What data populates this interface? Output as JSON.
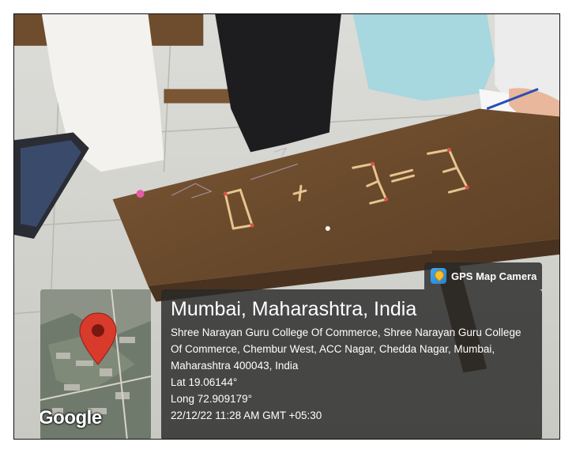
{
  "stamp": {
    "app_badge_label": "GPS Map Camera",
    "app_badge_icon": "map-pin-app-icon",
    "location_title": "Mumbai, Maharashtra, India",
    "address": "Shree Narayan Guru College Of Commerce, Shree Narayan Guru College Of Commerce, Chembur West, ACC Nagar, Chedda Nagar, Mumbai, Maharashtra 400043, India",
    "latitude": "Lat 19.06144°",
    "longitude": "Long 72.909179°",
    "datetime": "22/12/22 11:28 AM GMT +05:30",
    "map_watermark": "Google"
  },
  "photo": {
    "subject": "matchstick puzzle on wooden desk",
    "puzzle_glyphs": [
      "0",
      "+",
      "3",
      "=",
      "3"
    ]
  },
  "colors": {
    "overlay": "#282828",
    "text": "#ffffff",
    "pin": "#d83a2c",
    "desk": "#6b4a2c"
  }
}
